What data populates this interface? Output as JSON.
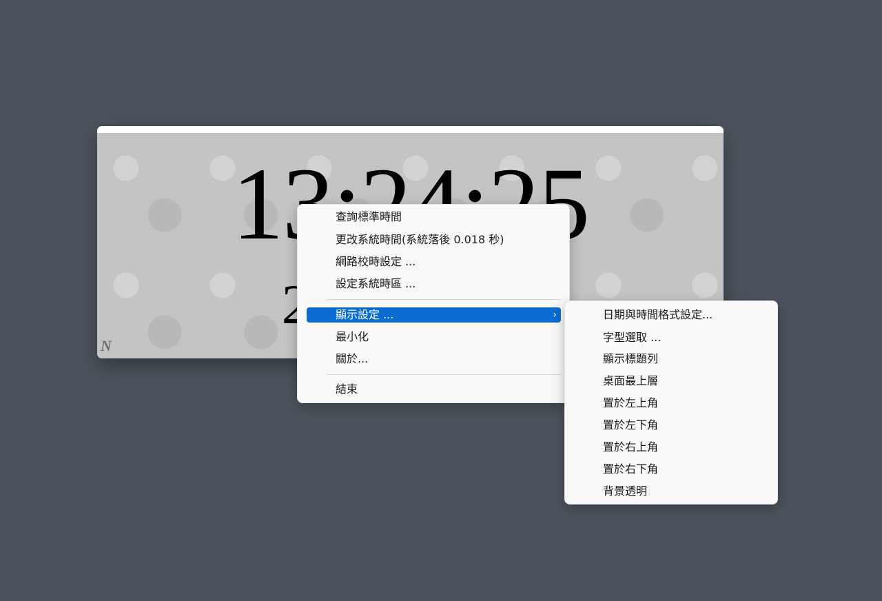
{
  "clock": {
    "time": "13:24:25",
    "date": "2023/12/07",
    "logo": "N"
  },
  "context_menu": {
    "items": [
      {
        "label": "查詢標準時間"
      },
      {
        "label": "更改系統時間(系統落後 0.018 秒)"
      },
      {
        "label": "網路校時設定 ..."
      },
      {
        "label": "設定系統時區 ..."
      },
      {
        "label": "顯示設定 ...",
        "has_submenu": true
      },
      {
        "label": "最小化"
      },
      {
        "label": "關於..."
      },
      {
        "label": "結束"
      }
    ],
    "submenu_icon": "chevron-right-icon"
  },
  "display_submenu": {
    "items": [
      {
        "label": "日期與時間格式設定..."
      },
      {
        "label": "字型選取 ..."
      },
      {
        "label": "顯示標題列"
      },
      {
        "label": "桌面最上層"
      },
      {
        "label": "置於左上角"
      },
      {
        "label": "置於左下角"
      },
      {
        "label": "置於右上角"
      },
      {
        "label": "置於右下角"
      },
      {
        "label": "背景透明"
      }
    ]
  },
  "colors": {
    "desktop_background": "#4c535c",
    "menu_background": "#f9f9f9",
    "highlight": "#0a6cd0"
  }
}
